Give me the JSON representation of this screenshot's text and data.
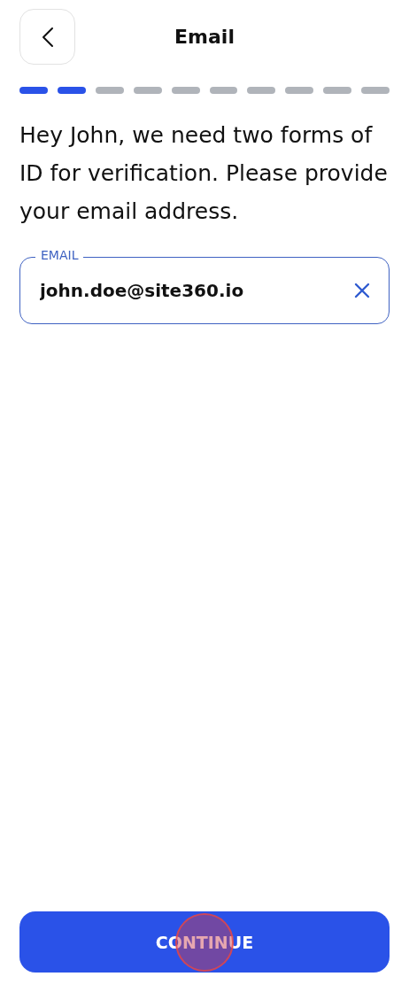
{
  "header": {
    "title": "Email"
  },
  "progress": [
    {
      "done": true
    },
    {
      "done": true
    },
    {
      "done": false
    },
    {
      "done": false
    },
    {
      "done": false
    },
    {
      "done": false
    },
    {
      "done": false
    },
    {
      "done": false
    },
    {
      "done": false
    },
    {
      "done": false
    }
  ],
  "message": "Hey John, we need two forms of ID for verification. Please provide your email address.",
  "email_field": {
    "label": "EMAIL",
    "value": "john.doe@site360.io"
  },
  "continue_button": {
    "label": "CONTINUE"
  }
}
